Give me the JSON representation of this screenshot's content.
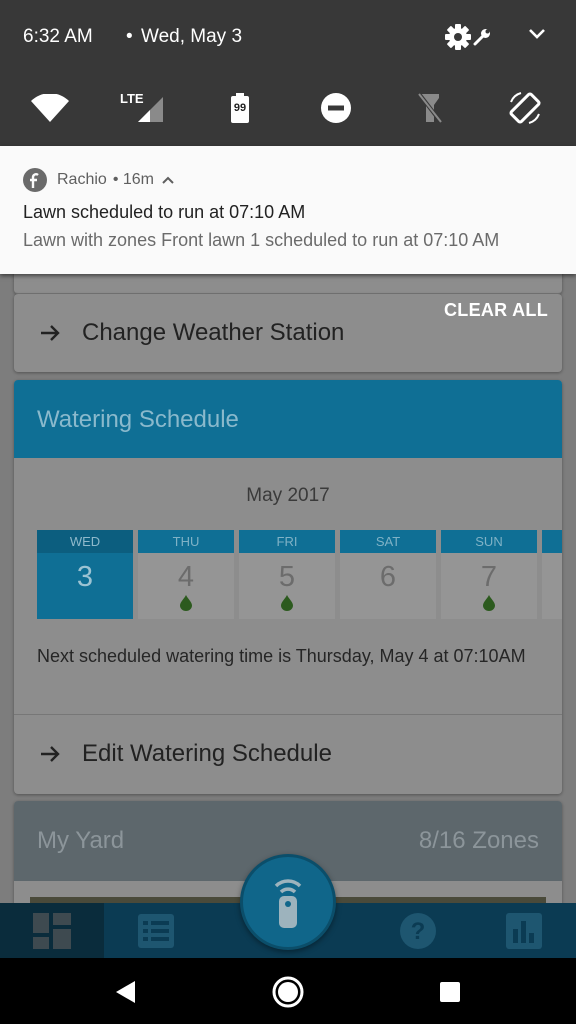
{
  "status_bar": {
    "time": "6:32 AM",
    "separator": "•",
    "date": "Wed, May 3"
  },
  "quick_settings": {
    "network_label": "LTE",
    "battery_level": "99"
  },
  "notification": {
    "app_name": "Rachio",
    "age": "• 16m",
    "title": "Lawn scheduled to run at 07:10 AM",
    "text": "Lawn with zones Front lawn 1 scheduled to run at 07:10 AM"
  },
  "clear_all_label": "CLEAR ALL",
  "weather_card": {
    "action_label": "Change Weather Station"
  },
  "schedule_card": {
    "title": "Watering Schedule",
    "month": "May 2017",
    "days": [
      {
        "dow": "WED",
        "num": "3",
        "watering": false,
        "today": true
      },
      {
        "dow": "THU",
        "num": "4",
        "watering": true,
        "today": false
      },
      {
        "dow": "FRI",
        "num": "5",
        "watering": true,
        "today": false
      },
      {
        "dow": "SAT",
        "num": "6",
        "watering": false,
        "today": false
      },
      {
        "dow": "SUN",
        "num": "7",
        "watering": true,
        "today": false
      }
    ],
    "next_watering": "Next scheduled watering time is Thursday, May 4 at 07:10AM",
    "edit_label": "Edit Watering Schedule"
  },
  "yard_card": {
    "title": "My Yard",
    "zones": "8/16 Zones"
  },
  "colors": {
    "accent": "#0f6f95",
    "notification_bg": "#fafafa",
    "shade_bg": "#383838"
  },
  "icons": [
    "settings-icon",
    "wrench-icon",
    "chevron-down-icon",
    "wifi-icon",
    "signal-icon",
    "battery-icon",
    "dnd-icon",
    "flashlight-icon",
    "auto-rotate-icon",
    "dashboard-icon",
    "list-icon",
    "remote-icon",
    "help-icon",
    "chart-icon",
    "back-icon",
    "home-icon",
    "recents-icon"
  ]
}
